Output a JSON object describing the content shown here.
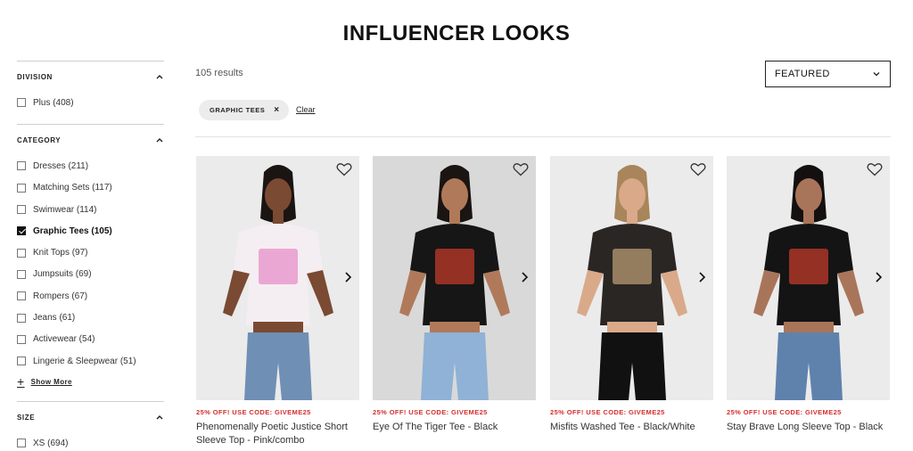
{
  "page_title": "INFLUENCER LOOKS",
  "results_text": "105 results",
  "sort": {
    "selected": "FEATURED"
  },
  "active_filter": {
    "label": "GRAPHIC TEES",
    "remove": "×"
  },
  "clear_label": "Clear",
  "sidebar": {
    "division": {
      "title": "DIVISION",
      "options": [
        {
          "label": "Plus (408)",
          "checked": false
        }
      ]
    },
    "category": {
      "title": "CATEGORY",
      "options": [
        {
          "label": "Dresses (211)",
          "checked": false
        },
        {
          "label": "Matching Sets (117)",
          "checked": false
        },
        {
          "label": "Swimwear (114)",
          "checked": false
        },
        {
          "label": "Graphic Tees (105)",
          "checked": true
        },
        {
          "label": "Knit Tops (97)",
          "checked": false
        },
        {
          "label": "Jumpsuits (69)",
          "checked": false
        },
        {
          "label": "Rompers (67)",
          "checked": false
        },
        {
          "label": "Jeans (61)",
          "checked": false
        },
        {
          "label": "Activewear (54)",
          "checked": false
        },
        {
          "label": "Lingerie & Sleepwear (51)",
          "checked": false
        }
      ],
      "show_more": "Show More"
    },
    "size": {
      "title": "SIZE",
      "options": [
        {
          "label": "XS (694)",
          "checked": false
        }
      ]
    }
  },
  "products": [
    {
      "promo": "25% OFF! USE CODE: GIVEME25",
      "name": "Phenomenally Poetic Justice Short Sleeve Top - Pink/combo",
      "top_color": "#f4eef2",
      "top_accent": "#e88fc8",
      "bottom_color": "#6f8fb5",
      "skin": "#7a4a32",
      "hair": "#1a1412"
    },
    {
      "promo": "25% OFF! USE CODE: GIVEME25",
      "name": "Eye Of The Tiger Tee - Black",
      "top_color": "#161616",
      "top_accent": "#c0392b",
      "bottom_color": "#8fb2d6",
      "skin": "#b07a5a",
      "hair": "#1a1412"
    },
    {
      "promo": "25% OFF! USE CODE: GIVEME25",
      "name": "Misfits Washed Tee - Black/White",
      "top_color": "#2a2624",
      "top_accent": "#b89a72",
      "bottom_color": "#111111",
      "skin": "#d9a98a",
      "hair": "#a8855a"
    },
    {
      "promo": "25% OFF! USE CODE: GIVEME25",
      "name": "Stay Brave Long Sleeve Top - Black",
      "top_color": "#141414",
      "top_accent": "#c0392b",
      "bottom_color": "#5f82ad",
      "skin": "#a9755a",
      "hair": "#141010"
    }
  ],
  "icons": {
    "heart": "heart-icon",
    "next": "chevron-right-icon",
    "collapse": "chevron-up-icon",
    "sort": "chevron-down-icon",
    "plus": "plus-icon"
  }
}
